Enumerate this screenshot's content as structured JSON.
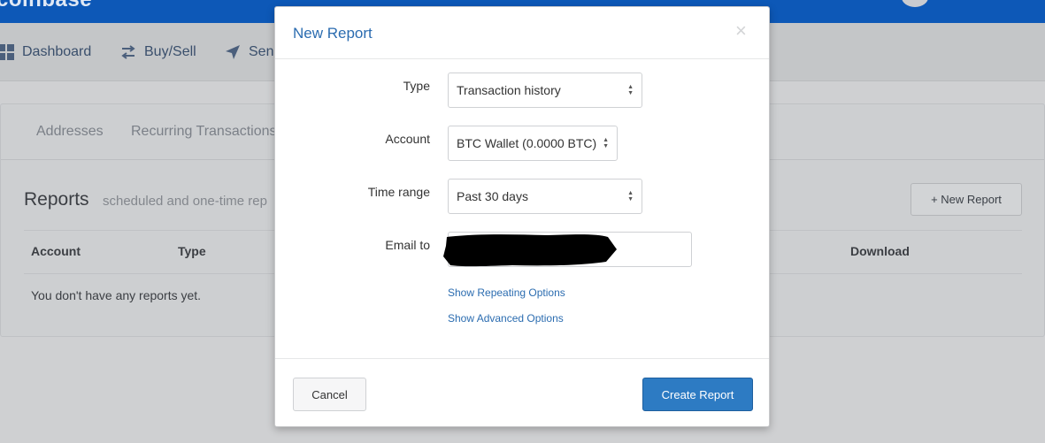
{
  "app": {
    "brand_text": "coinbase"
  },
  "nav": {
    "items": [
      {
        "label": "Dashboard",
        "icon": "grid-icon"
      },
      {
        "label": "Buy/Sell",
        "icon": "swap-arrows-icon"
      },
      {
        "label": "Send",
        "icon": "paper-plane-icon"
      }
    ]
  },
  "subtabs": [
    "Addresses",
    "Recurring Transactions"
  ],
  "reports": {
    "title": "Reports",
    "subtitle": "scheduled and one-time rep",
    "new_report_label": "+ New Report",
    "columns": [
      "Account",
      "Type",
      "Download"
    ],
    "empty_message": "You don't have any reports yet."
  },
  "modal": {
    "title": "New Report",
    "close_icon": "close-icon",
    "fields": {
      "type": {
        "label": "Type",
        "value": "Transaction history"
      },
      "account": {
        "label": "Account",
        "value": "BTC Wallet (0.0000 BTC)"
      },
      "time_range": {
        "label": "Time range",
        "value": "Past 30 days"
      },
      "email": {
        "label": "Email to",
        "value": ""
      }
    },
    "links": {
      "repeating": "Show Repeating Options",
      "advanced": "Show Advanced Options"
    },
    "buttons": {
      "cancel": "Cancel",
      "create": "Create Report"
    }
  },
  "colors": {
    "topbar": "#0d58b7",
    "primary_button": "#2d7bc3",
    "link": "#2b6cb0",
    "overlay_background": "#cfd0d2"
  }
}
